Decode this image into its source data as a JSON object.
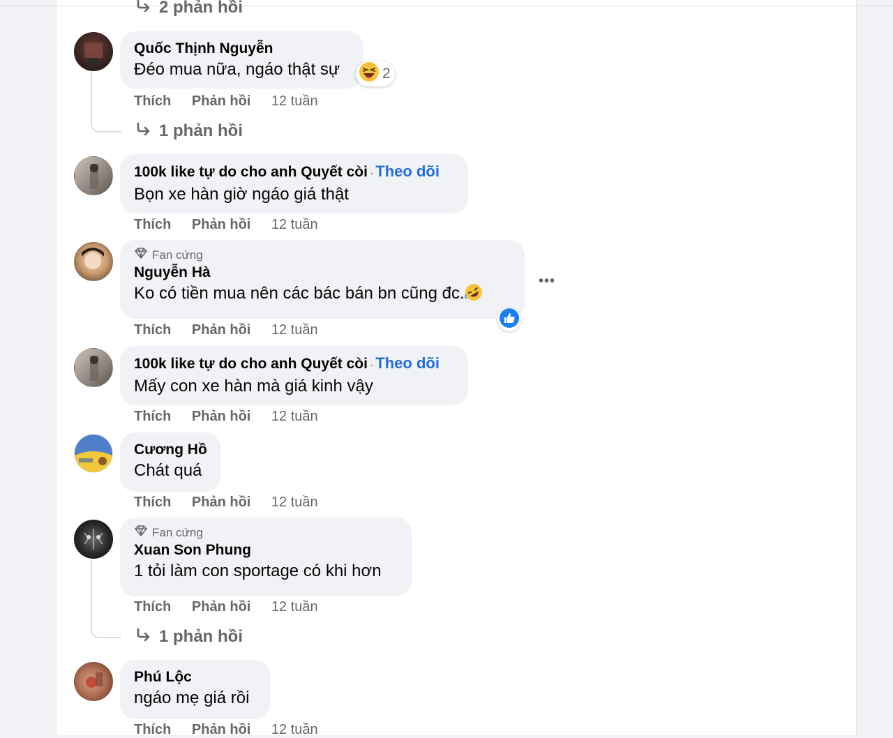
{
  "top_replies": {
    "label": "2 phản hồi"
  },
  "actions": {
    "like": "Thích",
    "reply": "Phản hồi"
  },
  "colors": {
    "follow": "#216fdb",
    "bubble": "#f0f2f5",
    "muted": "#65676b"
  },
  "comments": [
    {
      "name": "Quốc Thịnh Nguyễn",
      "text": "Đéo mua nữa, ngáo thật sự",
      "time": "12 tuần",
      "reaction": {
        "icon": "laughing-squint-emoji-icon",
        "count": "2"
      },
      "replies": "1 phản hồi"
    },
    {
      "name": "100k like tự do cho anh Quyết còi",
      "follow": "Theo dõi",
      "text": "Bọn xe hàn giờ ngáo giá thật",
      "time": "12 tuần"
    },
    {
      "badge": "Fan cứng",
      "name": "Nguyễn Hà",
      "text": "Ko có tiền mua nên các bác bán bn cũng đc.",
      "time": "12 tuần",
      "trailing_emoji": "rofl-emoji-icon",
      "reaction": {
        "icon": "like-thumb-icon"
      }
    },
    {
      "name": "100k like tự do cho anh Quyết còi",
      "follow": "Theo dõi",
      "text": "Mấy con xe hàn mà giá kinh vậy",
      "time": "12 tuần"
    },
    {
      "name": "Cương Hồ",
      "text": "Chát quá",
      "time": "12 tuần"
    },
    {
      "badge": "Fan cứng",
      "name": "Xuan Son Phung",
      "text": "1 tỏi làm con sportage có khi hơn",
      "time": "12 tuần",
      "replies": "1 phản hồi"
    },
    {
      "name": "Phú Lộc",
      "text": "ngáo mẹ giá rồi",
      "time": "12 tuần"
    }
  ]
}
